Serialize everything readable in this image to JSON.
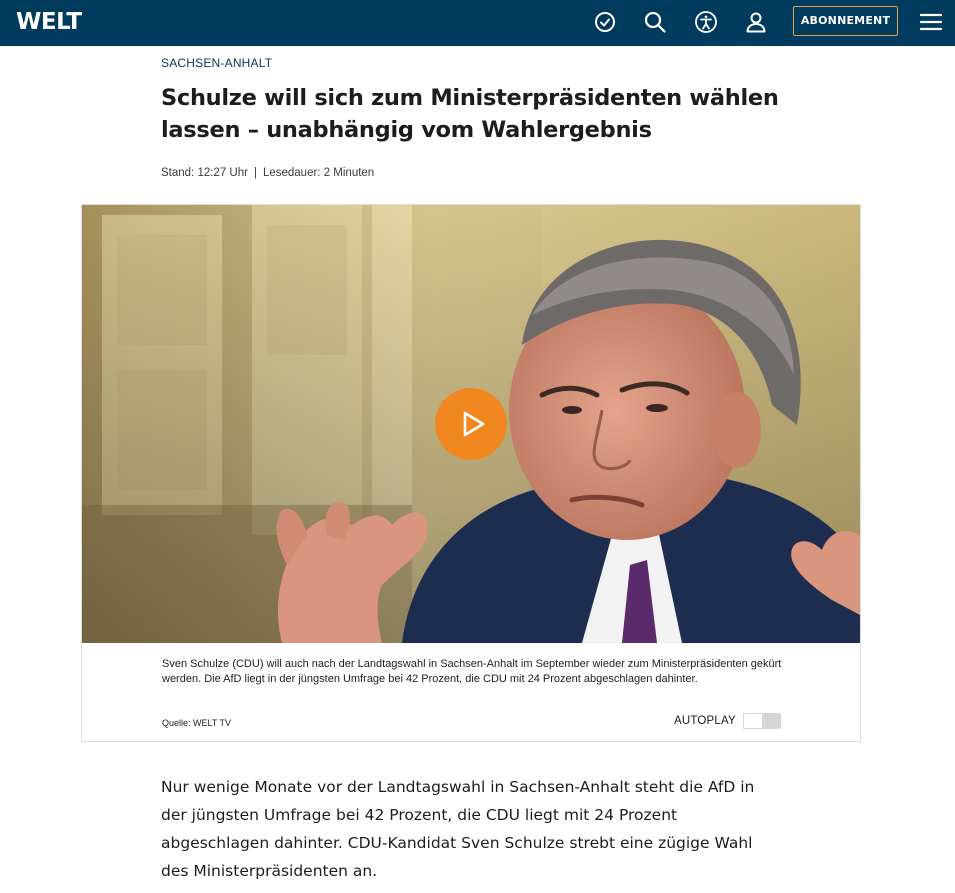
{
  "header": {
    "logo": "WELT",
    "icons": [
      "clock-icon",
      "search-icon",
      "accessibility-icon",
      "user-icon",
      "menu-icon"
    ],
    "subscribe_label": "ABONNEMENT",
    "background_color": "#003a5d",
    "accent_color": "#e8a046"
  },
  "article": {
    "kicker": "SACHSEN-ANHALT",
    "headline_part1": "Schulze will sich zum Ministerpräsidenten wählen lassen – ",
    "headline_highlight": "unabhängig vom Wahlergebnis",
    "highlight_color": "#fbf434",
    "meta": {
      "stand": "Stand: 12:27 Uhr",
      "separator": "|",
      "lesedauer": "Lesedauer: 2 Minuten"
    },
    "video": {
      "caption": "Sven Schulze (CDU) will auch nach der Landtagswahl in Sachsen-Anhalt im September wieder zum Ministerpräsidenten gekürt werden. Die AfD liegt in der jüngsten Umfrage bei 42 Prozent, die CDU mit 24 Prozent abgeschlagen dahinter.",
      "source": "Quelle: WELT TV",
      "autoplay_label": "AUTOPLAY",
      "autoplay_on": false,
      "play_button_color": "#f1881f"
    },
    "body": "Nur wenige Monate vor der Landtagswahl in Sachsen-Anhalt steht die AfD in der jüngsten Umfrage bei 42 Prozent, die CDU liegt mit 24 Prozent abgeschlagen dahinter. CDU-Kandidat Sven Schulze strebt eine zügige Wahl des Ministerpräsidenten an."
  }
}
